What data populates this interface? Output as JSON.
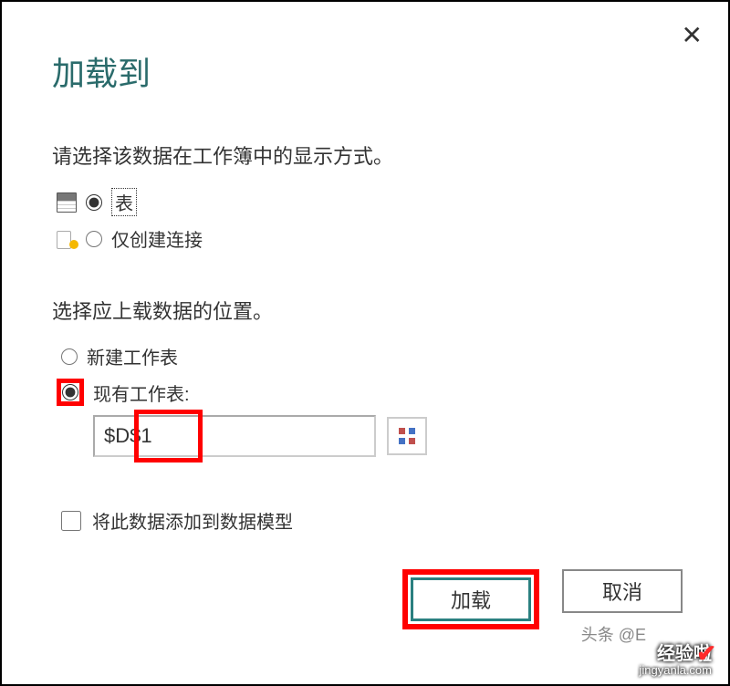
{
  "dialog": {
    "title": "加载到",
    "section1_subtitle": "请选择该数据在工作簿中的显示方式。",
    "option_table": "表",
    "option_connection": "仅创建连接",
    "section2_subtitle": "选择应上载数据的位置。",
    "option_new_sheet": "新建工作表",
    "option_existing_sheet": "现有工作表:",
    "cell_ref_value": "$D$1",
    "checkbox_label": "将此数据添加到数据模型",
    "btn_load": "加载",
    "btn_cancel": "取消"
  },
  "watermark": {
    "faded": "头条 @E",
    "line1": "经验啦",
    "line2": "jingyanla.com"
  }
}
